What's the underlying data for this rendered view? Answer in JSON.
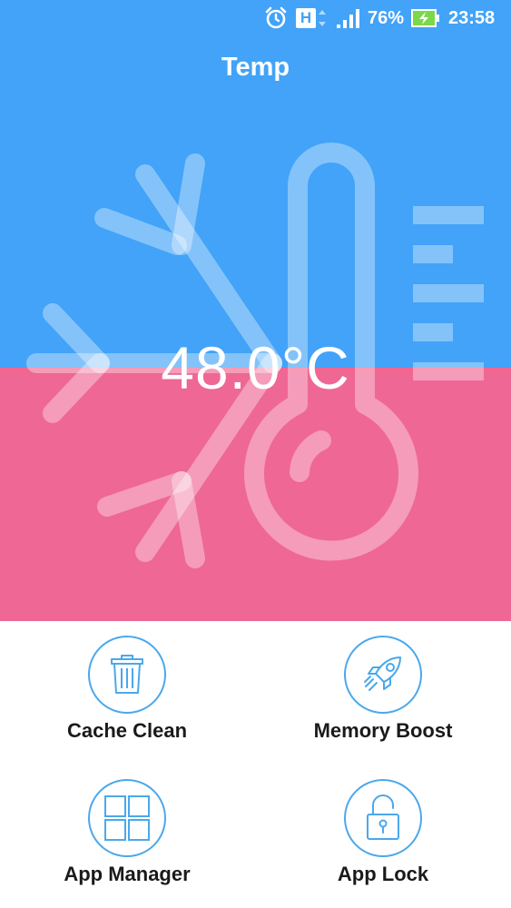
{
  "status_bar": {
    "battery_percent": "76%",
    "time": "23:58",
    "network_label": "H"
  },
  "header": {
    "title": "Temp"
  },
  "temperature": {
    "reading": "48.0°C"
  },
  "tools": [
    {
      "label": "Cache Clean",
      "icon": "trash-icon"
    },
    {
      "label": "Memory Boost",
      "icon": "rocket-icon"
    },
    {
      "label": "App Manager",
      "icon": "grid-icon"
    },
    {
      "label": "App Lock",
      "icon": "padlock-icon"
    }
  ],
  "colors": {
    "top_bg": "#42a3f8",
    "bottom_bg": "#ef6794",
    "accent": "#4aa8ec"
  }
}
